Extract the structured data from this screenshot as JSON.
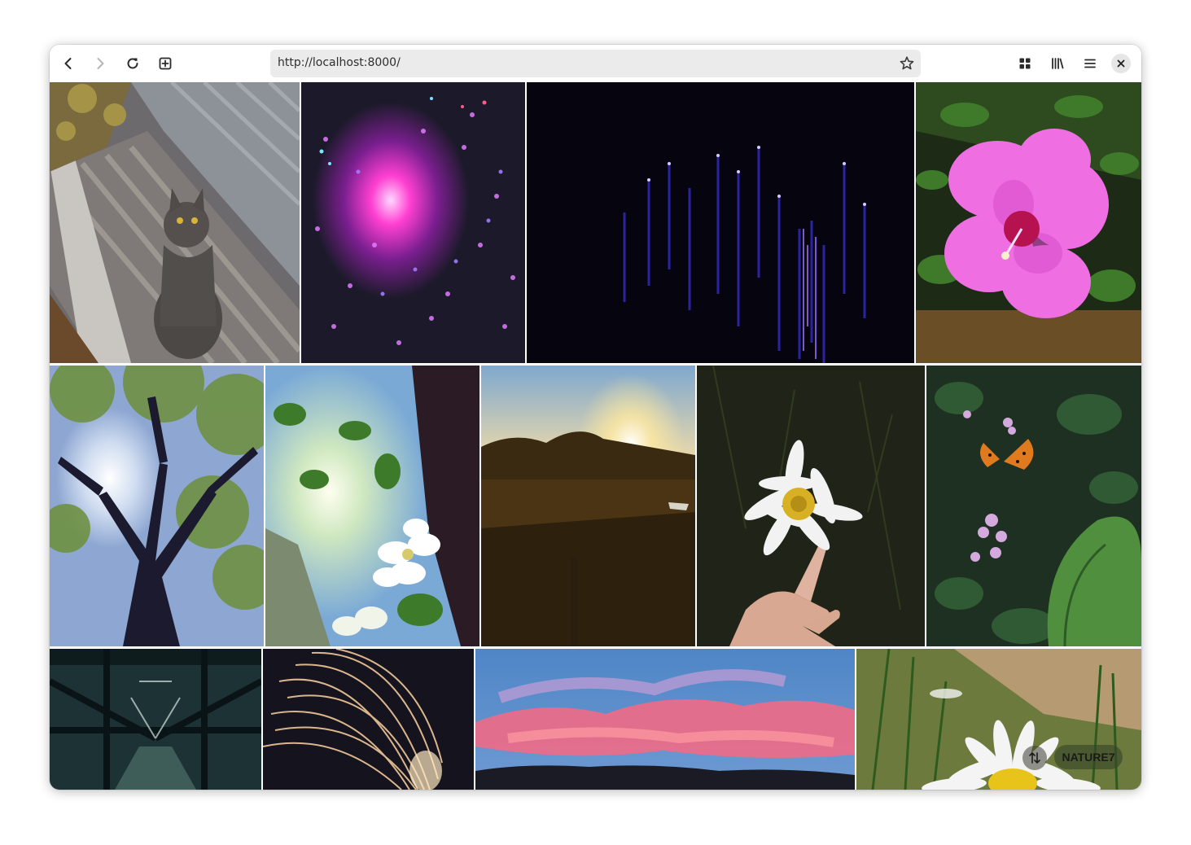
{
  "browser": {
    "url": "http://localhost:8000/",
    "icons": [
      "back-icon",
      "forward-icon",
      "reload-icon",
      "new-tab-icon",
      "bookmark-star-icon",
      "extensions-grid-icon",
      "library-icon",
      "menu-icon",
      "close-icon"
    ]
  },
  "gallery": {
    "photos": [
      "cat on wooden bench",
      "pink bokeh lights",
      "blue light streaks",
      "pink hibiscus flower",
      "tree silhouette against sun",
      "white blossoms with sun",
      "sunset over field",
      "hand holding daisy",
      "butterfly on flowers",
      "bridge under-structure",
      "sparkler streaks",
      "pink sunset clouds",
      "daisy in grass"
    ],
    "collection_label": "NATURE7",
    "sort_icon": "sort-arrows-icon"
  }
}
